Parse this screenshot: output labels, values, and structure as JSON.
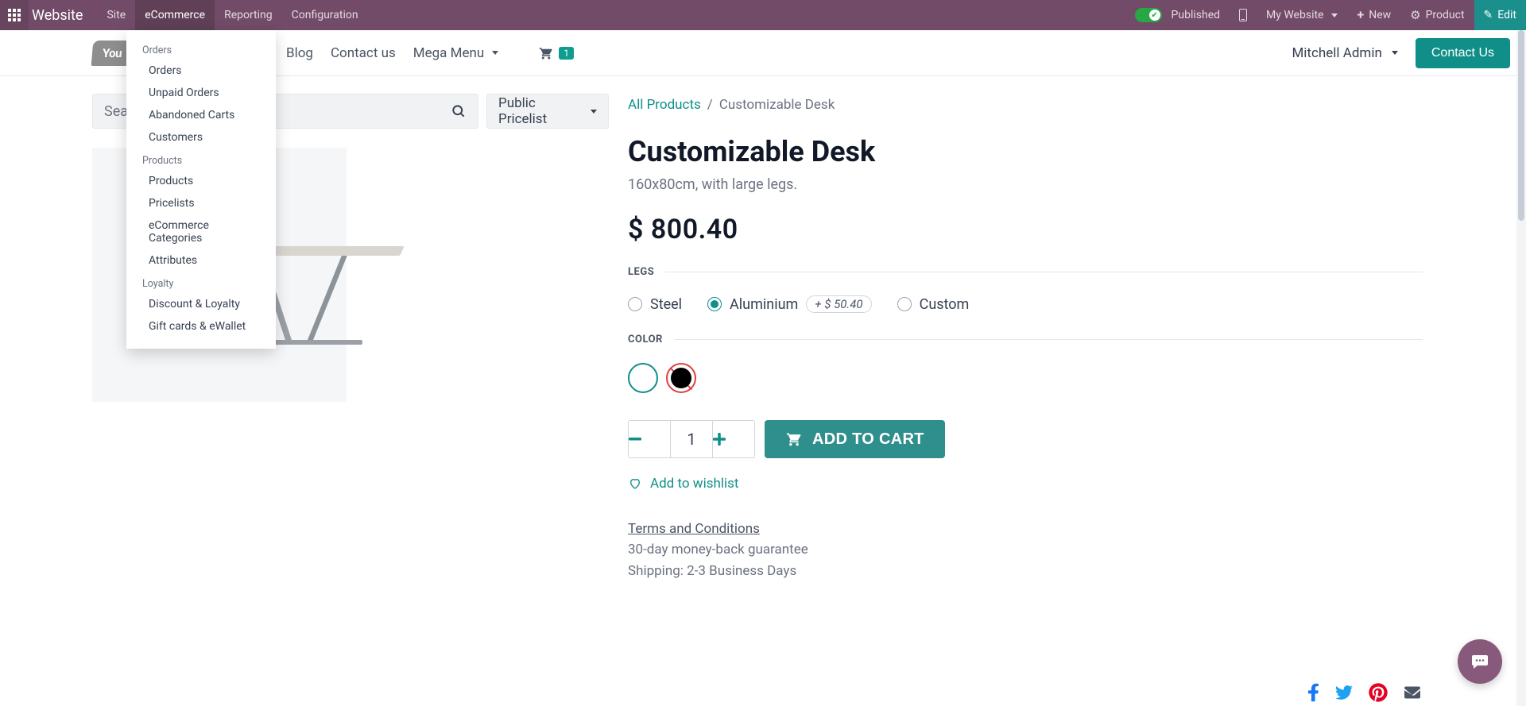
{
  "topbar": {
    "brand": "Website",
    "menu": [
      "Site",
      "eCommerce",
      "Reporting",
      "Configuration"
    ],
    "published_label": "Published",
    "my_website_label": "My Website",
    "new_label": "New",
    "product_label": "Product",
    "edit_label": "Edit"
  },
  "ecommerce_menu": {
    "groups": [
      {
        "title": "Orders",
        "items": [
          "Orders",
          "Unpaid Orders",
          "Abandoned Carts",
          "Customers"
        ]
      },
      {
        "title": "Products",
        "items": [
          "Products",
          "Pricelists",
          "eCommerce Categories",
          "Attributes"
        ]
      },
      {
        "title": "Loyalty",
        "items": [
          "Discount & Loyalty",
          "Gift cards & eWallet"
        ]
      }
    ]
  },
  "site_header": {
    "logo_text": "You",
    "nav": {
      "blog": "Blog",
      "contact": "Contact us",
      "mega": "Mega Menu"
    },
    "cart_count": "1",
    "user_name": "Mitchell Admin",
    "contact_us": "Contact Us"
  },
  "search": {
    "placeholder": "Sear",
    "pricelist": "Public Pricelist"
  },
  "breadcrumb": {
    "root": "All Products",
    "sep": "/",
    "current": "Customizable Desk"
  },
  "product": {
    "title": "Customizable Desk",
    "subtitle": "160x80cm, with large legs.",
    "price": "$ 800.40",
    "legs_label": "LEGS",
    "legs_options": {
      "steel": "Steel",
      "aluminium": "Aluminium",
      "aluminium_extra": "+  $ 50.40",
      "custom": "Custom"
    },
    "color_label": "COLOR",
    "qty": "1",
    "add_to_cart": "ADD TO CART",
    "wishlist": "Add to wishlist",
    "terms_link": "Terms and Conditions",
    "guarantee": "30-day money-back guarantee",
    "shipping": "Shipping: 2-3 Business Days"
  }
}
